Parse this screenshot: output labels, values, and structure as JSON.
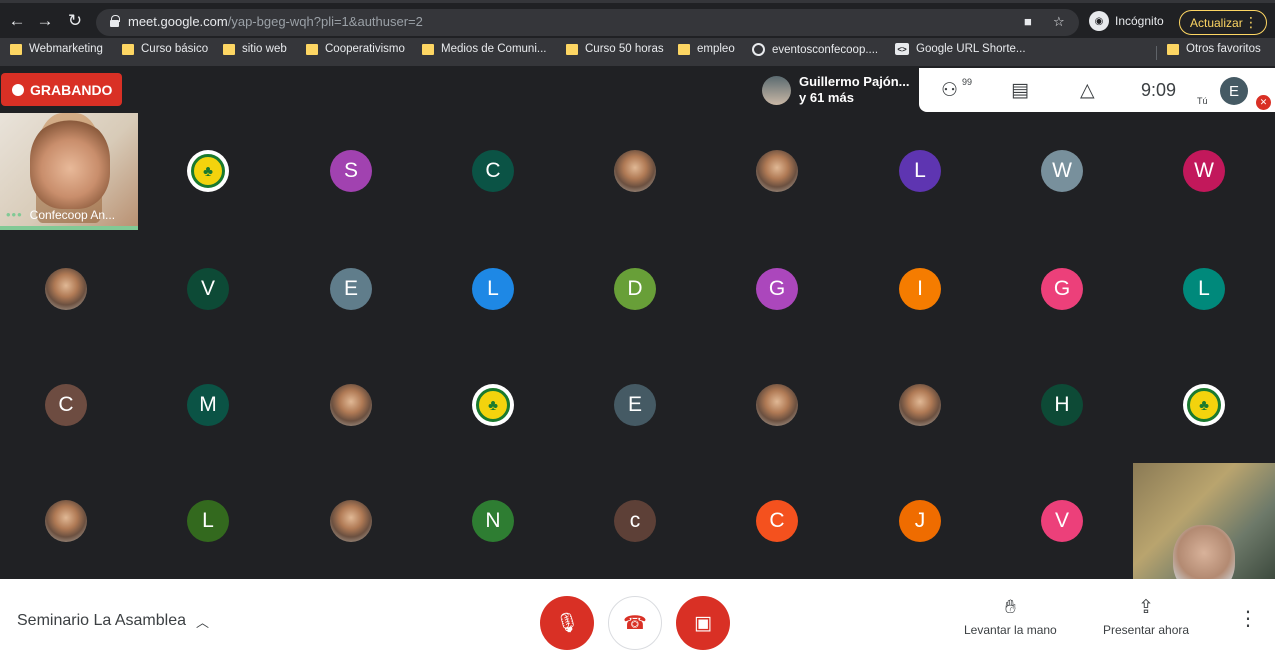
{
  "browser": {
    "url_host": "meet.google.com",
    "url_path": "/yap-bgeg-wqh?pli=1&authuser=2",
    "incognito_label": "Incógnito",
    "update_label": "Actualizar",
    "back_icon": "back-arrow-icon",
    "forward_icon": "forward-arrow-icon",
    "reload_icon": "reload-icon"
  },
  "bookmarks": [
    {
      "label": "Webmarketing",
      "icon": "folder"
    },
    {
      "label": "Curso básico",
      "icon": "folder"
    },
    {
      "label": "sitio web",
      "icon": "folder"
    },
    {
      "label": "Cooperativismo",
      "icon": "folder"
    },
    {
      "label": "Medios de Comuni...",
      "icon": "folder"
    },
    {
      "label": "Curso 50 horas",
      "icon": "folder"
    },
    {
      "label": "empleo",
      "icon": "folder"
    },
    {
      "label": "eventosconfecoop....",
      "icon": "globe"
    },
    {
      "label": "Google URL Shorte...",
      "icon": "google-url"
    }
  ],
  "other_bookmarks": "Otros favoritos",
  "meet": {
    "recording_label": "GRABANDO",
    "presenter_name": "Guillermo Pajón...",
    "presenter_more": "y 61 más",
    "people_count": "99",
    "time": "9:09",
    "self_initial": "E",
    "self_label": "Tú",
    "self_tile_name": "Confecoop An...",
    "meeting_name": "Seminario La Asamblea",
    "raise_hand_label": "Levantar la mano",
    "present_label": "Presentar ahora",
    "colors": {
      "recording": "#d93025",
      "accent_green": "#81c995",
      "background": "#202124"
    }
  },
  "participants_row1": [
    {
      "type": "logo",
      "letter": ""
    },
    {
      "type": "letter",
      "letter": "S",
      "color": "#a142b0"
    },
    {
      "type": "letter",
      "letter": "C",
      "color": "#0b5345"
    },
    {
      "type": "photo",
      "letter": ""
    },
    {
      "type": "photo",
      "letter": ""
    },
    {
      "type": "letter",
      "letter": "L",
      "color": "#5e35b1"
    },
    {
      "type": "letter",
      "letter": "W",
      "color": "#78909c"
    },
    {
      "type": "letter",
      "letter": "W",
      "color": "#c2185b"
    }
  ],
  "participants_row2": [
    {
      "type": "photo",
      "letter": ""
    },
    {
      "type": "letter",
      "letter": "V",
      "color": "#0d4a36"
    },
    {
      "type": "letter",
      "letter": "E",
      "color": "#607d8b"
    },
    {
      "type": "letter",
      "letter": "L",
      "color": "#1e88e5"
    },
    {
      "type": "letter",
      "letter": "D",
      "color": "#689f38"
    },
    {
      "type": "letter",
      "letter": "G",
      "color": "#ab47bc"
    },
    {
      "type": "letter",
      "letter": "I",
      "color": "#f57c00"
    },
    {
      "type": "letter",
      "letter": "G",
      "color": "#ec407a"
    },
    {
      "type": "letter",
      "letter": "L",
      "color": "#00897b"
    }
  ],
  "participants_row3": [
    {
      "type": "letter",
      "letter": "C",
      "color": "#6d4c41"
    },
    {
      "type": "letter",
      "letter": "M",
      "color": "#0b5345"
    },
    {
      "type": "photo",
      "letter": ""
    },
    {
      "type": "logo",
      "letter": ""
    },
    {
      "type": "letter",
      "letter": "E",
      "color": "#455a64"
    },
    {
      "type": "photo",
      "letter": ""
    },
    {
      "type": "photo",
      "letter": ""
    },
    {
      "type": "letter",
      "letter": "H",
      "color": "#0d4a36"
    },
    {
      "type": "logo",
      "letter": ""
    }
  ],
  "participants_row4": [
    {
      "type": "photo",
      "letter": ""
    },
    {
      "type": "letter",
      "letter": "L",
      "color": "#33691e"
    },
    {
      "type": "photo",
      "letter": ""
    },
    {
      "type": "letter",
      "letter": "N",
      "color": "#2e7d32"
    },
    {
      "type": "letter",
      "letter": "c",
      "color": "#5d4037"
    },
    {
      "type": "letter",
      "letter": "C",
      "color": "#f4511e"
    },
    {
      "type": "letter",
      "letter": "J",
      "color": "#ef6c00"
    },
    {
      "type": "letter",
      "letter": "V",
      "color": "#ec407a"
    }
  ]
}
